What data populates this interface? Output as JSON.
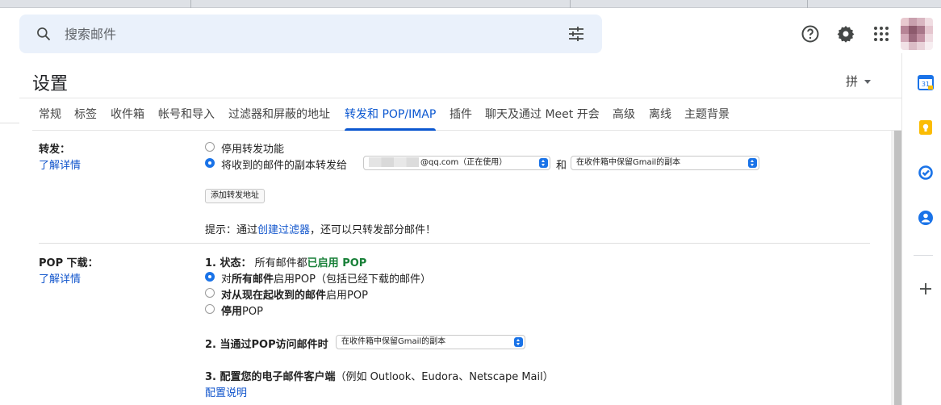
{
  "search": {
    "placeholder": "搜索邮件"
  },
  "header": {
    "help_icon": "help-icon",
    "settings_icon": "gear-icon",
    "apps_icon": "apps-grid-icon"
  },
  "settings": {
    "title": "设置",
    "input_method": "拼",
    "tabs": [
      "常规",
      "标签",
      "收件箱",
      "帐号和导入",
      "过滤器和屏蔽的地址",
      "转发和 POP/IMAP",
      "插件",
      "聊天及通过 Meet 开会",
      "高级",
      "离线",
      "主题背景"
    ],
    "active_tab": "转发和 POP/IMAP"
  },
  "forwarding": {
    "label": "转发：",
    "learn_more": "了解详情",
    "option_disable": "停用转发功能",
    "option_forward": "将收到的邮件的副本转发给",
    "forward_address_suffix": "@qq.com（正在使用）",
    "and_text": "和",
    "keep_copy": "在收件箱中保留Gmail的副本",
    "add_button": "添加转发地址",
    "tip_prefix": "提示：通过",
    "tip_link": "创建过滤器",
    "tip_suffix": "，还可以只转发部分邮件！"
  },
  "pop": {
    "label": "POP 下载：",
    "learn_more": "了解详情",
    "status_prefix": "1. 状态：",
    "status_text": "所有邮件都",
    "status_enabled": "已启用 POP",
    "opt1_bold": "所有邮件",
    "opt1_pre": "对",
    "opt1_post": "启用POP（包括已经下载的邮件）",
    "opt2_bold": "对从现在起收到的邮件",
    "opt2_post": "启用POP",
    "opt3_bold": "停用",
    "opt3_post": "POP",
    "access_label": "2. 当通过POP访问邮件时",
    "access_select": "在收件箱中保留Gmail的副本",
    "config_label": "3. 配置您的电子邮件客户端",
    "config_examples": "（例如 Outlook、Eudora、Netscape Mail）",
    "config_link": "配置说明"
  },
  "colors": {
    "accent": "#0b57d0",
    "link": "#1155cc",
    "green": "#188038",
    "search_bg": "#eaf1fb"
  }
}
